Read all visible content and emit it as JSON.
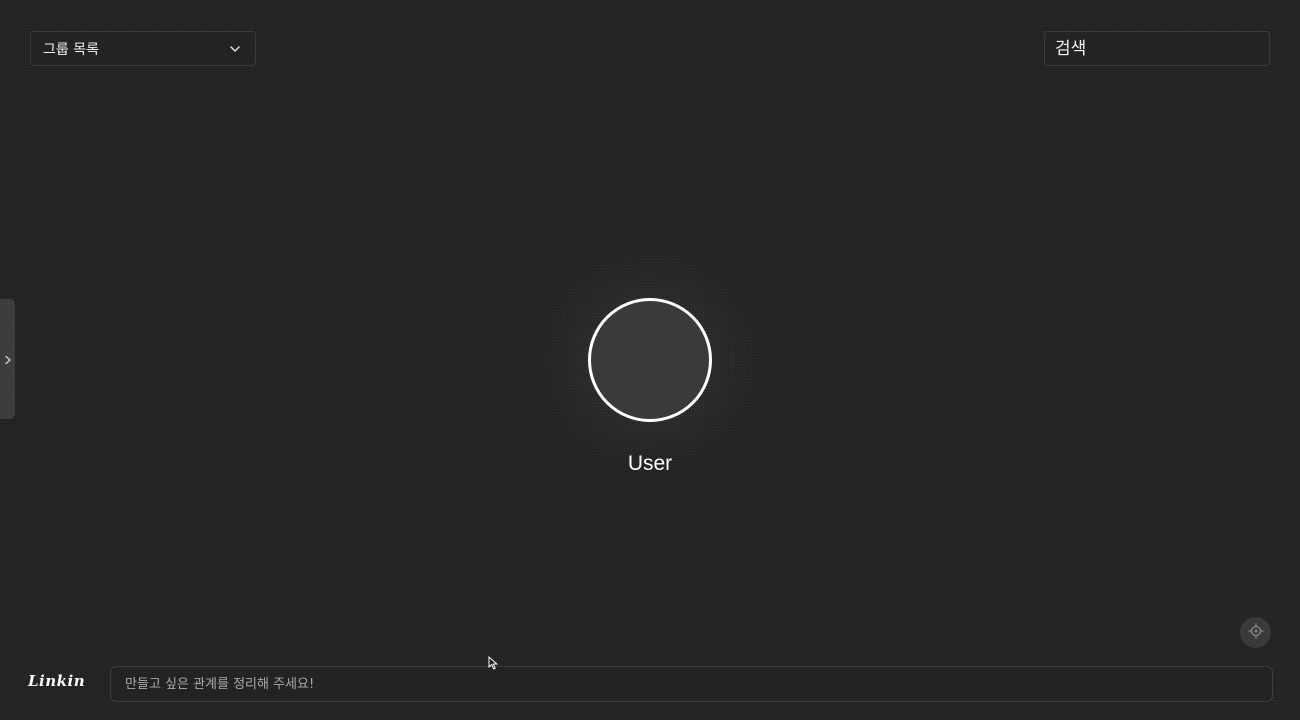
{
  "header": {
    "group_select_label": "그룹 목록",
    "search_placeholder": "검색"
  },
  "graph": {
    "center_node_label": "User"
  },
  "footer": {
    "logo_text": "Linkin",
    "prompt_placeholder": "만들고 싶은 관계를 정리해 주세요!"
  },
  "icons": {
    "group_select": "chevron-down-icon",
    "sidebar_toggle": "chevron-right-icon",
    "recenter": "crosshair-icon",
    "cursor": "mouse-pointer-icon"
  },
  "colors": {
    "background": "#222222",
    "node_border": "#ffffff",
    "node_fill": "#3a3a3a",
    "control_border": "#3a3a3a"
  }
}
